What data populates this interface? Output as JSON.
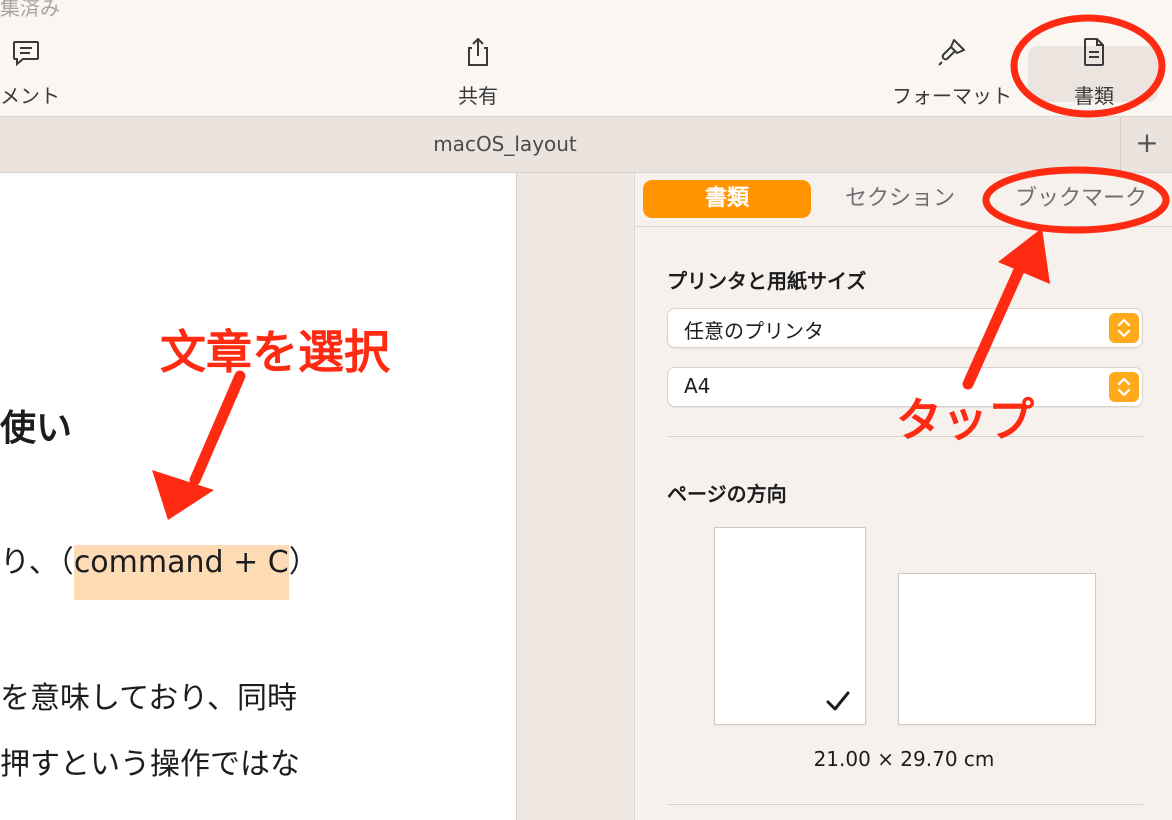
{
  "toolbar": {
    "partial_top_text": "集済み",
    "comment_label": "メント",
    "share_label": "共有",
    "format_label": "フォーマット",
    "document_label": "書類"
  },
  "tab": {
    "title": "macOS_layout",
    "add_label": "+"
  },
  "document": {
    "heading": "使い",
    "line1_prefix": "り、（",
    "line1_highlight": "command + C",
    "line1_suffix": "）",
    "line2": "を意味しており、同時",
    "line3": "押すという操作ではな"
  },
  "inspector": {
    "tabs": [
      {
        "label": "書類",
        "active": true
      },
      {
        "label": "セクション",
        "active": false
      },
      {
        "label": "ブックマーク",
        "active": false
      }
    ],
    "printer_section_title": "プリンタと用紙サイズ",
    "printer_value": "任意のプリンタ",
    "paper_value": "A4",
    "orientation_title": "ページの方向",
    "orientation_selected": "portrait",
    "dimensions": "21.00 × 29.70 cm"
  },
  "annotations": {
    "select_text": "文章を選択",
    "tap_text": "タップ",
    "color": "#ff2a12"
  }
}
